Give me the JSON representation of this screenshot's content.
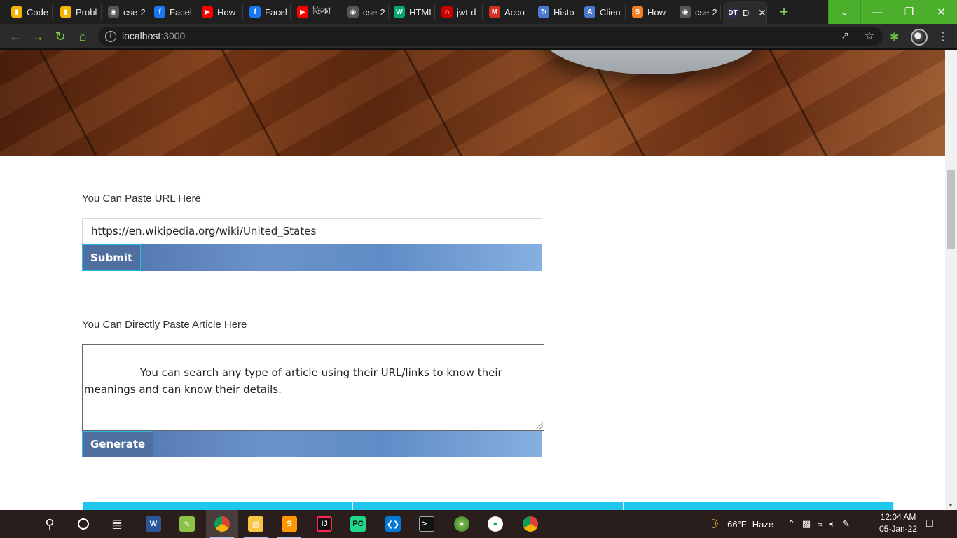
{
  "browser": {
    "tabs": [
      {
        "title": "Code",
        "icon": "chart-icon",
        "color": "#f4b400"
      },
      {
        "title": "Probl",
        "icon": "chart-icon",
        "color": "#f4b400"
      },
      {
        "title": "cse-2",
        "icon": "github-icon",
        "color": "#555555"
      },
      {
        "title": "Facel",
        "icon": "facebook-icon",
        "color": "#1877f2"
      },
      {
        "title": "How",
        "icon": "youtube-icon",
        "color": "#ff0000"
      },
      {
        "title": "Facel",
        "icon": "facebook-icon",
        "color": "#1877f2"
      },
      {
        "title": "তিকা",
        "icon": "youtube-icon",
        "color": "#ff0000"
      },
      {
        "title": "cse-2",
        "icon": "github-icon",
        "color": "#555555"
      },
      {
        "title": "HTMI",
        "icon": "w3-icon",
        "color": "#04aa6d"
      },
      {
        "title": "jwt-d",
        "icon": "npm-icon",
        "color": "#cb0000"
      },
      {
        "title": "Acco",
        "icon": "gmail-icon",
        "color": "#d93025"
      },
      {
        "title": "Histo",
        "icon": "history-icon",
        "color": "#4a7bd0"
      },
      {
        "title": "Clien",
        "icon": "api-icon",
        "color": "#4a7bd0"
      },
      {
        "title": "How",
        "icon": "stackoverflow-icon",
        "color": "#f48024"
      },
      {
        "title": "cse-2",
        "icon": "github-icon",
        "color": "#555555"
      },
      {
        "title": "D",
        "icon": "dt-icon",
        "color": "#2d2d4a",
        "active": true
      }
    ],
    "url_host": "localhost",
    "url_port": ":3000"
  },
  "page": {
    "url_label": "You Can Paste URL Here",
    "url_value": "https://en.wikipedia.org/wiki/United_States",
    "submit_label": "Submit",
    "article_label": "You Can Directly Paste Article Here",
    "article_value": "You can search any type of article using their URL/links to know their meanings and can know their details.",
    "generate_label": "Generate"
  },
  "taskbar": {
    "weather_temp": "66°F",
    "weather_desc": "Haze",
    "time": "12:04 AM",
    "date": "05-Jan-22"
  },
  "colors": {
    "accent_green": "#4caf2c",
    "button_blue": "#4e6f9f",
    "card_cyan": "#1ec7ee"
  }
}
